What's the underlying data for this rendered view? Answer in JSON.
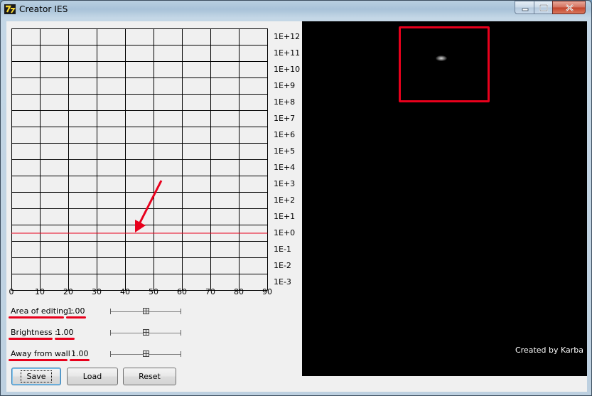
{
  "window": {
    "title": "Creator IES",
    "icon": "7zip-style-app-icon",
    "controls": [
      "minimize-icon",
      "maximize-icon",
      "close-icon"
    ]
  },
  "graph": {
    "y_labels": [
      "1E+12",
      "1E+11",
      "1E+10",
      "1E+9",
      "1E+8",
      "1E+7",
      "1E+6",
      "1E+5",
      "1E+4",
      "1E+3",
      "1E+2",
      "1E+1",
      "1E+0",
      "1E-1",
      "1E-2",
      "1E-3"
    ],
    "x_labels": [
      "0",
      "10",
      "20",
      "30",
      "40",
      "50",
      "60",
      "70",
      "80",
      "90"
    ],
    "curve_value_label": "1E+0",
    "curve_color": "#e8001c",
    "grid_color": "#000000"
  },
  "params": [
    {
      "label": "Area of editing :",
      "value": "1.00",
      "slider_fraction": 0.5
    },
    {
      "label": "Brightness :",
      "value": "1.00",
      "slider_fraction": 0.5
    },
    {
      "label": "Away from wall :",
      "value": "1.00",
      "slider_fraction": 0.5
    }
  ],
  "buttons": {
    "save": "Save",
    "load": "Load",
    "reset": "Reset"
  },
  "preview": {
    "credit": "Created by Karba",
    "background": "#000000"
  },
  "annotations": {
    "color": "#e8001c"
  }
}
